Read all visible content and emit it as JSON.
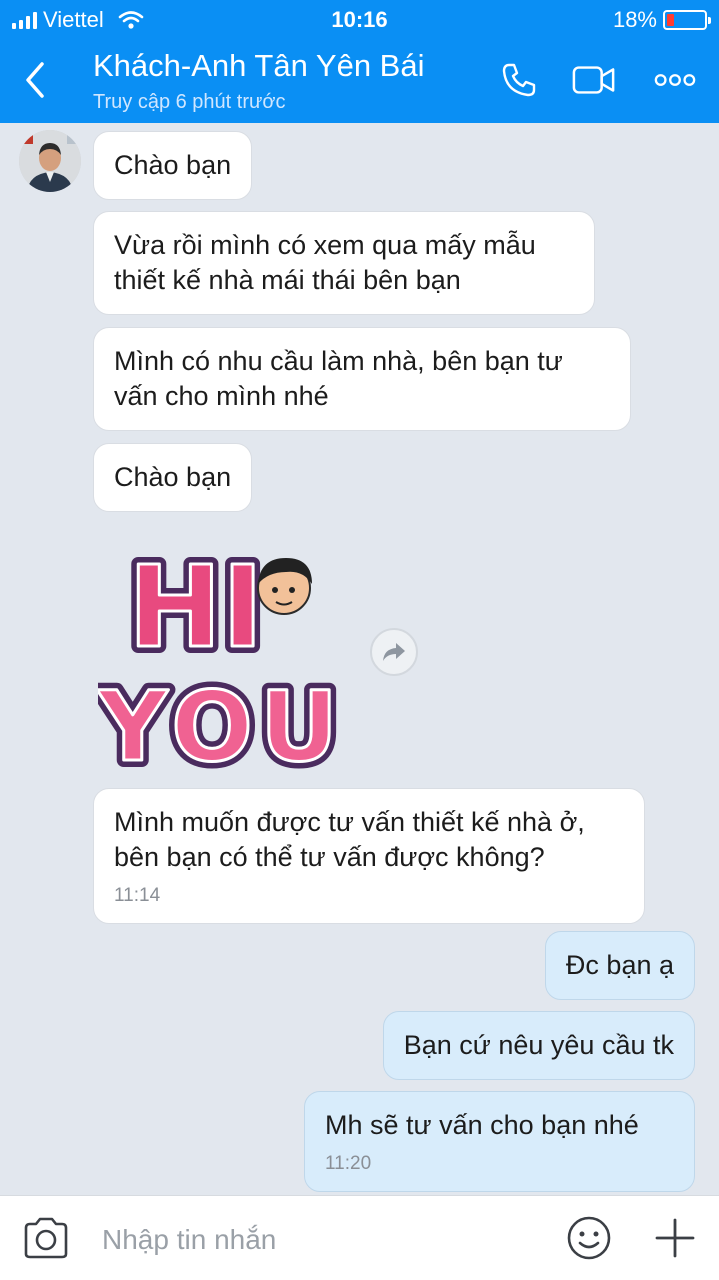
{
  "status_bar": {
    "carrier": "Viettel",
    "time": "10:16",
    "battery": "18%",
    "battery_color": "#ff3b30"
  },
  "header": {
    "title": "Khách-Anh Tân Yên Bái",
    "subtitle": "Truy cập 6 phút trước",
    "background": "#0a8ff4"
  },
  "icons": {
    "back": "chevron-left-icon",
    "call": "phone-icon",
    "video": "video-camera-icon",
    "more": "more-icon",
    "share": "forward-icon",
    "camera": "camera-icon",
    "emoji": "emoji-icon",
    "add": "plus-icon"
  },
  "messages": [
    {
      "from": "contact",
      "text": "Chào bạn"
    },
    {
      "from": "contact",
      "text": "Vừa rồi mình có xem qua mấy mẫu thiết kế nhà mái thái bên bạn"
    },
    {
      "from": "contact",
      "text": "Mình có nhu cầu làm nhà, bên bạn tư vấn cho mình nhé"
    },
    {
      "from": "contact",
      "text": "Chào bạn"
    },
    {
      "from": "contact",
      "type": "sticker",
      "text": "HI YOU"
    },
    {
      "from": "contact",
      "text": "Mình muốn được tư vấn thiết kế nhà ở, bên bạn có thể tư vấn được không?",
      "time": "11:14"
    },
    {
      "from": "me",
      "text": "Đc bạn ạ"
    },
    {
      "from": "me",
      "text": "Bạn cứ nêu yêu cầu tk"
    },
    {
      "from": "me",
      "text": "Mh sẽ tư vấn cho bạn nhé",
      "time": "11:20"
    }
  ],
  "composer": {
    "placeholder": "Nhập tin nhắn"
  }
}
